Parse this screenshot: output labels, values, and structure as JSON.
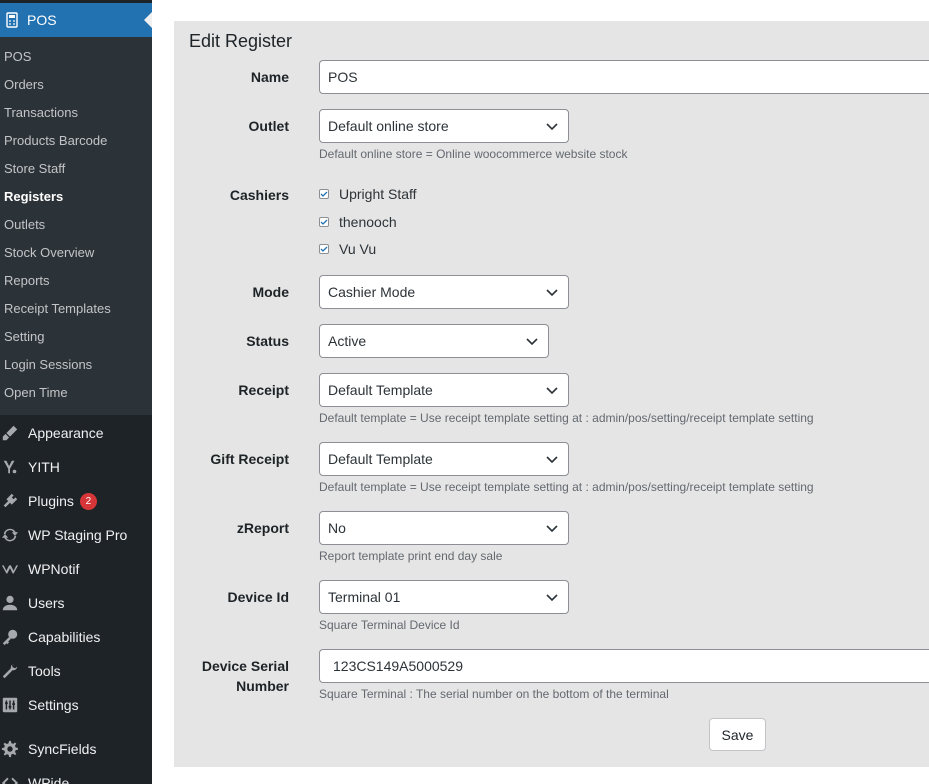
{
  "sidebar": {
    "current": "POS",
    "submenu": [
      {
        "label": "POS",
        "active": false
      },
      {
        "label": "Orders",
        "active": false
      },
      {
        "label": "Transactions",
        "active": false
      },
      {
        "label": "Products Barcode",
        "active": false
      },
      {
        "label": "Store Staff",
        "active": false
      },
      {
        "label": "Registers",
        "active": true
      },
      {
        "label": "Outlets",
        "active": false
      },
      {
        "label": "Stock Overview",
        "active": false
      },
      {
        "label": "Reports",
        "active": false
      },
      {
        "label": "Receipt Templates",
        "active": false
      },
      {
        "label": "Setting",
        "active": false
      },
      {
        "label": "Login Sessions",
        "active": false
      },
      {
        "label": "Open Time",
        "active": false
      }
    ],
    "menu": [
      {
        "label": "Appearance",
        "icon": "paintbrush-icon"
      },
      {
        "label": "YITH",
        "icon": "yith-icon"
      },
      {
        "label": "Plugins",
        "icon": "plugin-icon",
        "badge": "2"
      },
      {
        "label": "WP Staging Pro",
        "icon": "sync-icon"
      },
      {
        "label": "WPNotif",
        "icon": "wpnotif-icon"
      },
      {
        "label": "Users",
        "icon": "user-icon"
      },
      {
        "label": "Capabilities",
        "icon": "key-icon"
      },
      {
        "label": "Tools",
        "icon": "wrench-icon"
      },
      {
        "label": "Settings",
        "icon": "settings-icon"
      },
      {
        "label": "SyncFields",
        "icon": "gear-icon"
      },
      {
        "label": "WPide",
        "icon": "code-icon"
      }
    ]
  },
  "form": {
    "title": "Edit Register",
    "name_label": "Name",
    "name_value": "POS",
    "outlet_label": "Outlet",
    "outlet_value": "Default online store",
    "outlet_desc": "Default online store = Online woocommerce website stock",
    "cashiers_label": "Cashiers",
    "cashiers": [
      "Upright Staff",
      "thenooch",
      "Vu Vu"
    ],
    "mode_label": "Mode",
    "mode_value": "Cashier Mode",
    "status_label": "Status",
    "status_value": "Active",
    "receipt_label": "Receipt",
    "receipt_value": "Default Template",
    "receipt_desc": "Default template = Use receipt template setting at : admin/pos/setting/receipt template setting",
    "gift_label": "Gift Receipt",
    "gift_value": "Default Template",
    "gift_desc": "Default template = Use receipt template setting at : admin/pos/setting/receipt template setting",
    "zreport_label": "zReport",
    "zreport_value": "No",
    "zreport_desc": "Report template print end day sale",
    "device_label": "Device Id",
    "device_value": "Terminal 01",
    "device_desc": "Square Terminal Device Id",
    "serial_label_1": "Device Serial",
    "serial_label_2": "Number",
    "serial_value": "123CS149A5000529",
    "serial_desc": "Square Terminal : The serial number on the bottom of the terminal",
    "save_label": "Save"
  },
  "colors": {
    "sidebar_bg": "#1d2327",
    "submenu_bg": "#2c3338",
    "accent": "#2271b1",
    "panel_bg": "#e5e5e5",
    "badge": "#d63638"
  }
}
